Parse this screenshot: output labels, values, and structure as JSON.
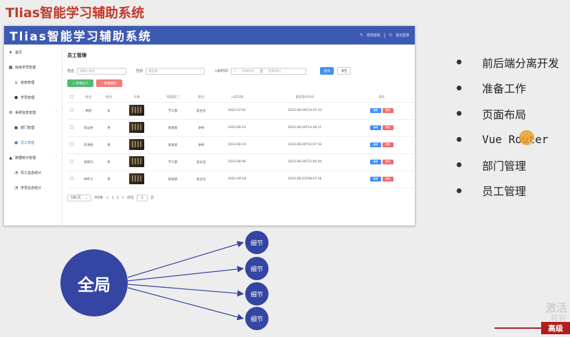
{
  "slide": {
    "title": "Tlias智能学习辅助系统",
    "bullets": [
      "前后端分离开发",
      "准备工作",
      "页面布局",
      "Vue Router",
      "部门管理",
      "员工管理"
    ]
  },
  "app": {
    "title": "Tlias智能学习辅助系统",
    "header": {
      "change_password": "修改密码",
      "separator": "|",
      "logout": "退出登录"
    },
    "sidebar": [
      {
        "label": "首页",
        "icon": "send-icon",
        "level": 0
      },
      {
        "label": "班级学员管理",
        "icon": "grid-icon",
        "level": 0,
        "arrow": "⌃"
      },
      {
        "label": "班级管理",
        "icon": "home-icon",
        "level": 1
      },
      {
        "label": "学员管理",
        "icon": "user-icon",
        "level": 1
      },
      {
        "label": "系统信息管理",
        "icon": "gear-icon",
        "level": 0,
        "arrow": "⌃"
      },
      {
        "label": "部门管理",
        "icon": "dept-icon",
        "level": 1
      },
      {
        "label": "员工管理",
        "icon": "user-icon",
        "level": 1,
        "active": true
      },
      {
        "label": "数据统计管理",
        "icon": "chart-icon",
        "level": 0,
        "arrow": "⌃"
      },
      {
        "label": "员工信息统计",
        "icon": "stats-icon",
        "level": 1
      },
      {
        "label": "学员信息统计",
        "icon": "stats-icon",
        "level": 1
      }
    ],
    "page_title": "员工管理",
    "filters": {
      "name_label": "姓名",
      "name_placeholder": "请输入姓名",
      "gender_label": "性别",
      "gender_placeholder": "请选择",
      "date_label": "入职时间",
      "date_start": "开始时间",
      "date_sep": "至",
      "date_end": "结束时间",
      "query": "查询",
      "clear": "清空"
    },
    "actions": {
      "add": "+ 新增员工",
      "batch_delete": "- 批量删除"
    },
    "table": {
      "headers": [
        "姓名",
        "性别",
        "头像",
        "所属部门",
        "职位",
        "入职日期",
        "最后操作时间",
        "操作"
      ],
      "rows": [
        {
          "name": "谢逊",
          "gender": "女",
          "dept": "学工部",
          "job": "班主任",
          "entry": "2022-07-01",
          "updated": "2023-08-29T14:47:33"
        },
        {
          "name": "宋远桥",
          "gender": "男",
          "dept": "研发部",
          "job": "讲师",
          "entry": "2023-08-10",
          "updated": "2023-08-29T14:46:11"
        },
        {
          "name": "风清扬",
          "gender": "男",
          "dept": "研发部",
          "job": "讲师",
          "entry": "2013-08-10",
          "updated": "2023-08-26T21:07:32"
        },
        {
          "name": "张晓凡",
          "gender": "男",
          "dept": "学工部",
          "job": "班主任",
          "entry": "2013-08-06",
          "updated": "2023-08-26T21:05:44"
        },
        {
          "name": "钟平之",
          "gender": "男",
          "dept": "研发部",
          "job": "班主任",
          "entry": "2022-09-18",
          "updated": "2023-08-23T08:07:16"
        }
      ],
      "edit": "编辑",
      "delete": "删除"
    },
    "pager": {
      "size": "5条/页",
      "total": "共6条",
      "prev": "<",
      "pages": [
        "1",
        "2"
      ],
      "next": ">",
      "goto": "前往",
      "goto_value": "1",
      "page_unit": "页"
    }
  },
  "diagram": {
    "center": "全局",
    "details": [
      "细节",
      "细节",
      "细节",
      "细节"
    ]
  },
  "watermark": {
    "line1": "激活",
    "line2": "转到"
  },
  "badge": "高级"
}
